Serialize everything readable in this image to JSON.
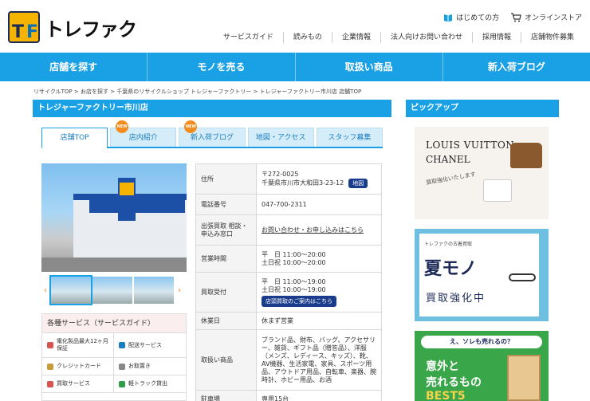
{
  "header": {
    "logo_text": "トレファク",
    "util": {
      "guide": "はじめての方",
      "store": "オンラインストア"
    },
    "subnav": [
      "サービスガイド",
      "読みもの",
      "企業情報",
      "法人向けお問い合わせ",
      "採用情報",
      "店舗物件募集"
    ]
  },
  "mainnav": [
    "店舗を探す",
    "モノを売る",
    "取扱い商品",
    "新入荷ブログ"
  ],
  "breadcrumb": "リサイクルTOP > お店を探す > 千葉県のリサイクルショップ トレジャーファクトリー > トレジャーファクトリー市川店 店舗TOP",
  "store": {
    "title": "トレジャーファクトリー市川店",
    "tabs": [
      {
        "label": "店舗TOP",
        "badge": ""
      },
      {
        "label": "店内紹介",
        "badge": "NEW"
      },
      {
        "label": "新入荷ブログ",
        "badge": "NEW"
      },
      {
        "label": "地図・アクセス",
        "badge": ""
      },
      {
        "label": "スタッフ募集",
        "badge": ""
      }
    ],
    "info": {
      "address_label": "住所",
      "postal": "〒272-0025",
      "address": "千葉県市川市大和田3-23-12",
      "map_button": "地図",
      "phone_label": "電話番号",
      "phone": "047-700-2311",
      "dispatch_label": "出張買取 相談・申込み窓口",
      "dispatch_link": "お問い合わせ・お申し込みはこちら",
      "hours_label": "営業時間",
      "hours_weekday": "平　日 11:00～20:00",
      "hours_weekend": "土日祝 10:00～20:00",
      "buy_label": "買取受付",
      "buy_weekday": "平　日 11:00～19:00",
      "buy_weekend": "土日祝 10:00～19:00",
      "buy_button": "店頭買取のご案内はこちら",
      "holiday_label": "休業日",
      "holiday": "休まず営業",
      "items_label": "取扱い商品",
      "items": "ブランド品、財布、バッグ、アクセサリー、雑貨、ギフト品（贈答品）、洋服（メンズ、レディース、キッズ）、靴、AV機器、生活家電、家具、スポーツ用品、アウトドア用品、自転車、楽器、腕時計、ホビー用品、お酒",
      "parking_label": "駐車場",
      "parking": "専用15台"
    },
    "services_title": "各種サービス（サービスガイド）",
    "services": [
      {
        "label": "電化製品最大12ヶ月保証",
        "color": "#d9534f"
      },
      {
        "label": "配送サービス",
        "color": "#1a7fc0"
      },
      {
        "label": "クレジットカード",
        "color": "#c89b3c"
      },
      {
        "label": "お取置き",
        "color": "#888888"
      },
      {
        "label": "買取サービス",
        "color": "#d9534f"
      },
      {
        "label": "軽トラック貸出",
        "color": "#2e9e4a"
      }
    ]
  },
  "pickup": {
    "title": "ピックアップ",
    "banner1": {
      "line1": "LOUIS VUITTON",
      "line2": "CHANEL",
      "line3": "買取強化いたします"
    },
    "banner2": {
      "small": "トレファクの古着買取",
      "big": "夏モノ",
      "sub": "買取強化中"
    },
    "banner3": {
      "question": "え、ソレも売れるの？",
      "l1": "意外と",
      "l2": "売れるもの",
      "l3": "BEST5"
    }
  }
}
